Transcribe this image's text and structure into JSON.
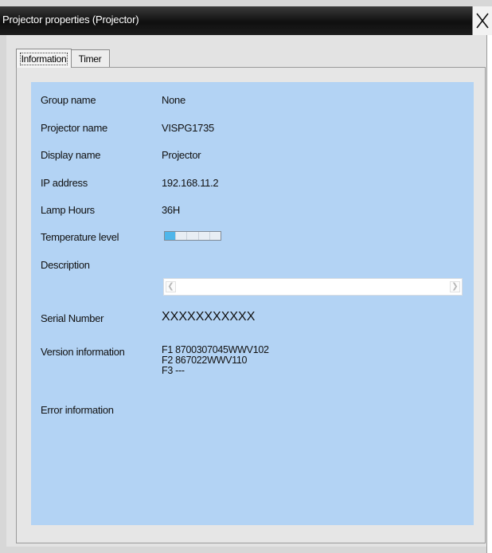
{
  "window": {
    "title": "Projector properties (Projector)",
    "close_icon": "close-x-icon"
  },
  "tabs": [
    {
      "label": "Information",
      "active": true
    },
    {
      "label": "Timer",
      "active": false
    }
  ],
  "info": {
    "group_name": {
      "label": "Group name",
      "value": "None"
    },
    "projector_name": {
      "label": "Projector name",
      "value": "VISPG1735"
    },
    "display_name": {
      "label": "Display name",
      "value": "Projector"
    },
    "ip_address": {
      "label": "IP address",
      "value": "192.168.11.2"
    },
    "lamp_hours": {
      "label": "Lamp Hours",
      "value": "36H"
    },
    "temperature_level": {
      "label": "Temperature level",
      "level_segments": 1,
      "total_segments": 5,
      "fill_color": "#4fb6ea"
    },
    "description": {
      "label": "Description",
      "value": ""
    },
    "serial_number": {
      "label": "Serial Number",
      "value": "XXXXXXXXXXX"
    },
    "version_information": {
      "label": "Version information",
      "lines": [
        "F1 8700307045WWV102",
        "F2 867022WWV110",
        "F3 ---"
      ]
    },
    "error_information": {
      "label": "Error information",
      "value": ""
    }
  },
  "colors": {
    "panel_background": "#b3d3f4",
    "titlebar": "#1a1a1a",
    "dialog_background": "#d7d7d7"
  }
}
